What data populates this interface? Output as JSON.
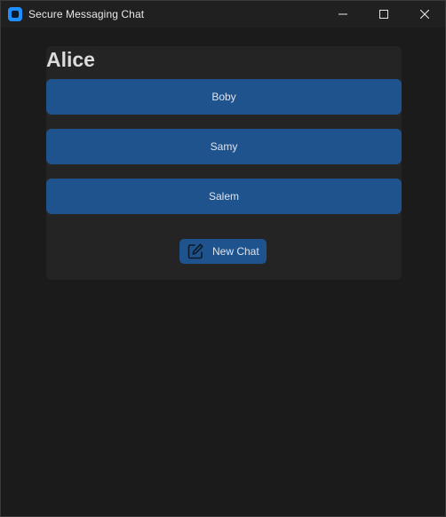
{
  "window": {
    "title": "Secure Messaging Chat"
  },
  "panel": {
    "user_name": "Alice",
    "contacts": [
      {
        "label": "Boby"
      },
      {
        "label": "Samy"
      },
      {
        "label": "Salem"
      }
    ],
    "new_chat": {
      "label": "New Chat",
      "icon": "edit-icon"
    }
  },
  "colors": {
    "window_bg": "#1b1b1b",
    "titlebar_bg": "#202020",
    "panel_bg": "#242424",
    "button_bg": "#1f538d",
    "button_text": "#dce4ee",
    "app_icon_accent": "#1f8fff"
  }
}
